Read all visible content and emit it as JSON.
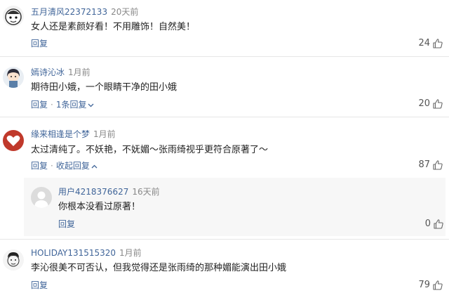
{
  "comments": [
    {
      "username": "五月清风22372133",
      "time": "20天前",
      "text": "女人还是素颜好看！不用雕饰！自然美！",
      "actions": {
        "reply": "回复"
      },
      "likes": "24",
      "avatar_icon": "cartoon-face-avatar-icon"
    },
    {
      "username": "嫣诗沁冰",
      "time": "1月前",
      "text": "期待田小娥，一个眼睛干净的田小娥",
      "actions": {
        "reply": "回复",
        "replies_toggle": "1条回复"
      },
      "likes": "20",
      "avatar_icon": "anime-girl-avatar-icon"
    },
    {
      "username": "缘来相逢是个梦",
      "time": "1月前",
      "text": "太过清纯了。不妖艳，不妩媚～张雨绮视乎更符合原著了～",
      "actions": {
        "reply": "回复",
        "replies_toggle": "收起回复"
      },
      "likes": "87",
      "avatar_icon": "red-heart-avatar-icon",
      "reply": {
        "username": "用户4218376627",
        "time": "16天前",
        "text": "你根本没看过原著！",
        "actions": {
          "reply": "回复"
        },
        "likes": "0",
        "avatar_icon": "default-user-avatar-icon"
      }
    },
    {
      "username": "HOLIDAY131515320",
      "time": "1月前",
      "text": "李沁很美不可否认，但我觉得还是张雨绮的那种媚能演出田小娥",
      "actions": {
        "reply": "回复"
      },
      "likes": "79",
      "avatar_icon": "sketch-face-avatar-icon"
    }
  ],
  "colors": {
    "username": "#406599",
    "action_link": "#406599",
    "time": "#888888",
    "reply_box_bg": "#f7f7f7",
    "divider": "#e6e6e6"
  },
  "icons": {
    "like": "thumbs-up-icon",
    "expand": "chevron-down-icon",
    "collapse": "chevron-up-icon"
  }
}
